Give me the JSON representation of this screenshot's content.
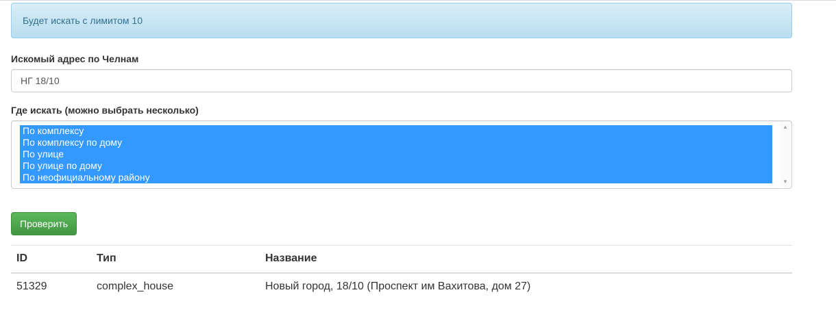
{
  "alert": {
    "text": "Будет искать с лимитом 10"
  },
  "address": {
    "label": "Искомый адрес по Челнам",
    "value": "НГ 18/10"
  },
  "search_in": {
    "label": "Где искать (можно выбрать несколько)",
    "options": [
      {
        "label": "По комплексу",
        "selected": true
      },
      {
        "label": "По комплексу по дому",
        "selected": true
      },
      {
        "label": "По улице",
        "selected": true
      },
      {
        "label": "По улице по дому",
        "selected": true
      },
      {
        "label": "По неофициальному району",
        "selected": true
      }
    ]
  },
  "actions": {
    "check_label": "Проверить"
  },
  "results": {
    "columns": [
      "ID",
      "Тип",
      "Название"
    ],
    "rows": [
      [
        "51329",
        "complex_house",
        "Новый город, 18/10 (Проспект им Вахитова, дом 27)"
      ]
    ]
  },
  "colors": {
    "alert_bg": "#d9edf7",
    "alert_text": "#31708f",
    "selection": "#3399ff",
    "button": "#5cb85c"
  }
}
